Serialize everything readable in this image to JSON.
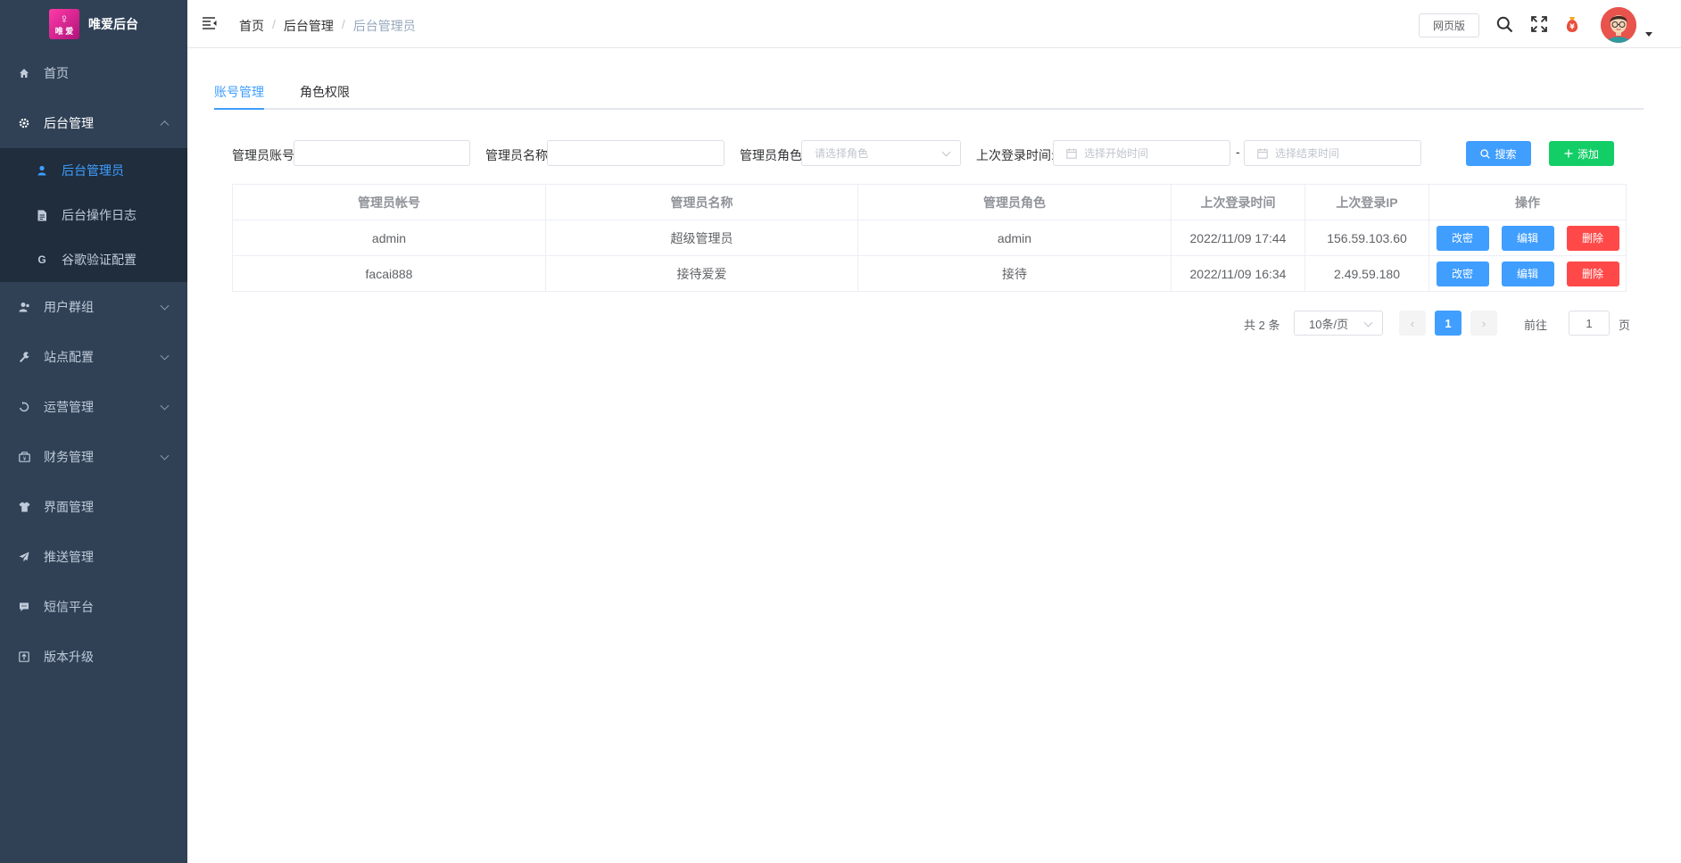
{
  "app": {
    "title": "唯爱后台",
    "logo_text": "唯 爱"
  },
  "sidebar": {
    "items": [
      {
        "label": "首页",
        "icon": "home-icon"
      },
      {
        "label": "后台管理",
        "icon": "gear-icon",
        "expanded": true,
        "children": [
          {
            "label": "后台管理员",
            "icon": "user-icon",
            "active": true
          },
          {
            "label": "后台操作日志",
            "icon": "document-icon"
          },
          {
            "label": "谷歌验证配置",
            "icon": "google-icon",
            "icon_text": "G"
          }
        ]
      },
      {
        "label": "用户群组",
        "icon": "user-group-icon"
      },
      {
        "label": "站点配置",
        "icon": "wrench-icon"
      },
      {
        "label": "运营管理",
        "icon": "recycle-icon"
      },
      {
        "label": "财务管理",
        "icon": "finance-icon"
      },
      {
        "label": "界面管理",
        "icon": "shirt-icon"
      },
      {
        "label": "推送管理",
        "icon": "send-icon"
      },
      {
        "label": "短信平台",
        "icon": "chat-icon"
      },
      {
        "label": "版本升级",
        "icon": "upgrade-icon"
      }
    ]
  },
  "header": {
    "breadcrumb": [
      "首页",
      "后台管理",
      "后台管理员"
    ],
    "breadcrumb_sep": "/",
    "web_button": "网页版"
  },
  "tabs": [
    {
      "label": "账号管理",
      "active": true
    },
    {
      "label": "角色权限",
      "active": false
    }
  ],
  "filters": {
    "account_label": "管理员账号:",
    "account_value": "",
    "name_label": "管理员名称:",
    "name_value": "",
    "role_label": "管理员角色:",
    "role_placeholder": "请选择角色",
    "login_time_label": "上次登录时间:",
    "start_placeholder": "选择开始时间",
    "range_sep": "-",
    "end_placeholder": "选择结束时间",
    "search_button": "搜索",
    "add_button": "添加"
  },
  "table": {
    "columns": [
      "管理员帐号",
      "管理员名称",
      "管理员角色",
      "上次登录时间",
      "上次登录IP",
      "操作"
    ],
    "rows": [
      {
        "account": "admin",
        "name": "超级管理员",
        "role": "admin",
        "last_login": "2022/11/09 17:44",
        "ip": "156.59.103.60"
      },
      {
        "account": "facai888",
        "name": "接待爱爱",
        "role": "接待",
        "last_login": "2022/11/09 16:34",
        "ip": "2.49.59.180"
      }
    ],
    "actions": {
      "password": "改密",
      "edit": "编辑",
      "delete": "删除"
    }
  },
  "pagination": {
    "total_text": "共 2 条",
    "page_size": "10条/页",
    "prev": "‹",
    "current_page": "1",
    "next": "›",
    "goto_label": "前往",
    "goto_value": "1",
    "page_suffix": "页"
  },
  "colors": {
    "sidebar_bg": "#304156",
    "submenu_bg": "#1f2d3d",
    "primary": "#409eff",
    "success": "#13ce66",
    "danger": "#ff4949"
  }
}
